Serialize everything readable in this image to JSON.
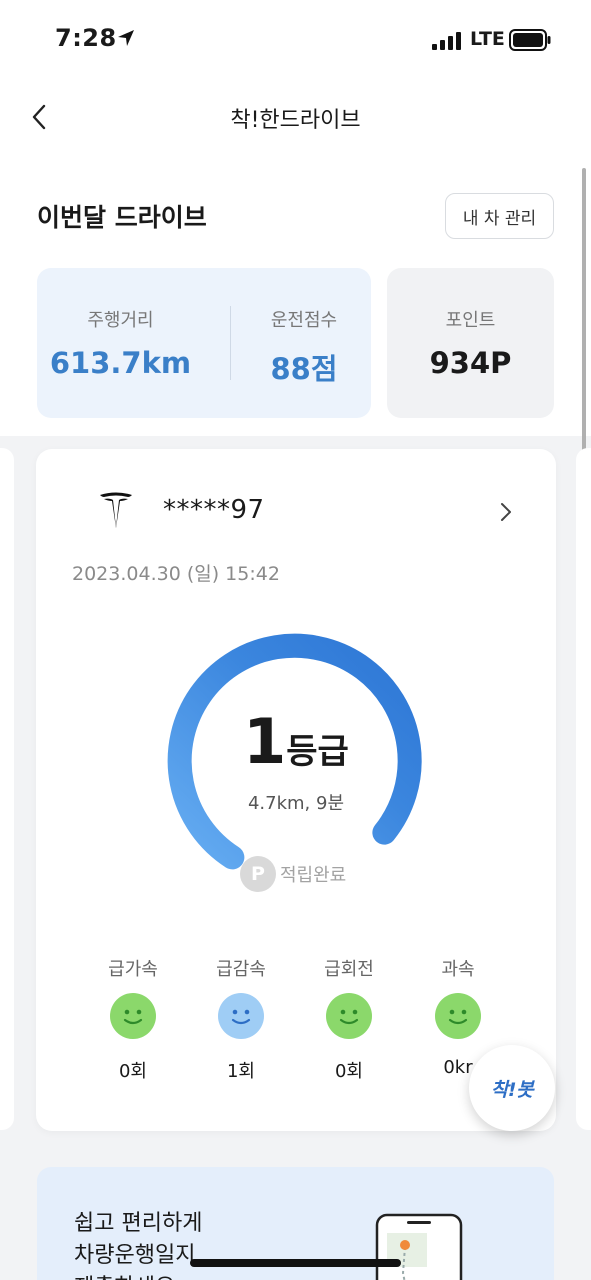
{
  "status_bar": {
    "time": "7:28",
    "network": "LTE"
  },
  "nav": {
    "title": "착!한드라이브",
    "back_icon": "chevron-left-icon"
  },
  "summary": {
    "section_title": "이번달 드라이브",
    "manage_button": "내 차 관리",
    "distance_label": "주행거리",
    "distance_value": "613.7km",
    "score_label": "운전점수",
    "score_value": "88점",
    "points_label": "포인트",
    "points_value": "934P"
  },
  "drive_card": {
    "car_brand_icon": "tesla-logo-icon",
    "plate": "*****97",
    "date": "2023.04.30 (일) 15:42",
    "grade_number": "1",
    "grade_unit": "등급",
    "trip_summary": "4.7km, 9분",
    "points_badge_icon": "P",
    "points_status": "적립완료",
    "behaviors": [
      {
        "label": "급가속",
        "value": "0회",
        "face": "green-smile",
        "color": "#8bd86b"
      },
      {
        "label": "급감속",
        "value": "1회",
        "face": "blue-smile",
        "color": "#9fcdf5"
      },
      {
        "label": "급회전",
        "value": "0회",
        "face": "green-smile",
        "color": "#8bd86b"
      },
      {
        "label": "과속",
        "value": "0kr",
        "face": "green-smile",
        "color": "#8bd86b"
      }
    ]
  },
  "fab": {
    "label": "착!봇"
  },
  "banner": {
    "line1": "쉽고 편리하게",
    "line2": "차량운행일지",
    "line3": "제출하세요"
  },
  "colors": {
    "accent_blue": "#3a7fc8",
    "gauge_start": "#63aaf0",
    "gauge_end": "#2e78d6",
    "stats_bg": "#ecf3fc",
    "points_bg": "#f1f2f4"
  }
}
